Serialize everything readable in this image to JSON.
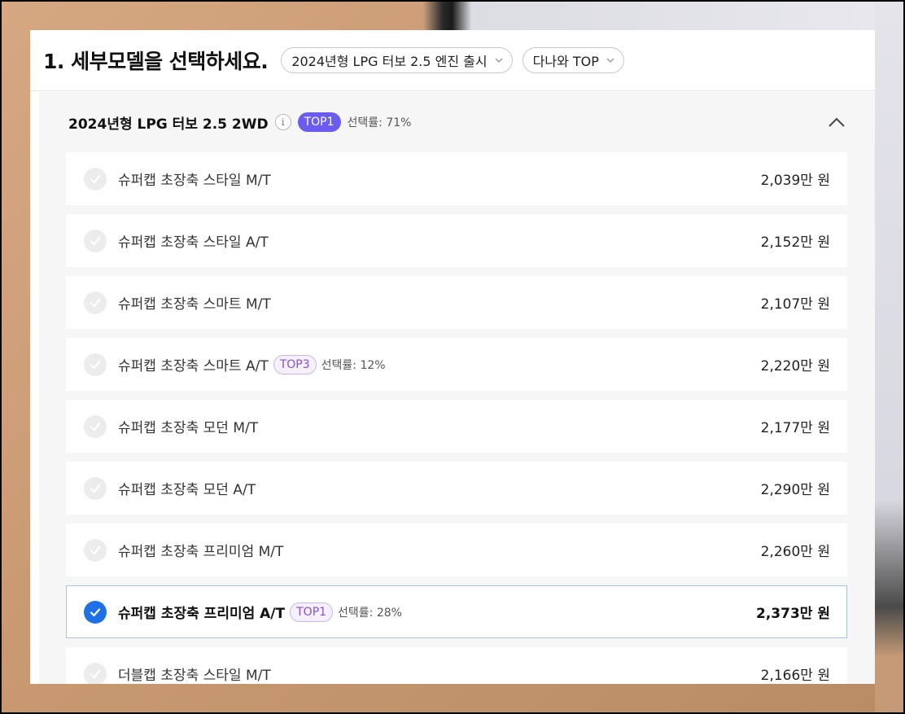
{
  "header": {
    "title": "1. 세부모델을 선택하세요.",
    "year_select": "2024년형 LPG 터보 2.5 엔진 출시",
    "sort_select": "다나와 TOP"
  },
  "group": {
    "title": "2024년형 LPG 터보 2.5 2WD",
    "badge": "TOP1",
    "rate": "선택률: 71%"
  },
  "options": [
    {
      "label": "슈퍼캡 초장축 스타일 M/T",
      "price": "2,039만 원"
    },
    {
      "label": "슈퍼캡 초장축 스타일 A/T",
      "price": "2,152만 원"
    },
    {
      "label": "슈퍼캡 초장축 스마트 M/T",
      "price": "2,107만 원"
    },
    {
      "label": "슈퍼캡 초장축 스마트 A/T",
      "price": "2,220만 원",
      "badge": "TOP3",
      "rate": "선택률: 12%"
    },
    {
      "label": "슈퍼캡 초장축 모던 M/T",
      "price": "2,177만 원"
    },
    {
      "label": "슈퍼캡 초장축 모던 A/T",
      "price": "2,290만 원"
    },
    {
      "label": "슈퍼캡 초장축 프리미엄 M/T",
      "price": "2,260만 원"
    },
    {
      "label": "슈퍼캡 초장축 프리미엄 A/T",
      "price": "2,373만 원",
      "badge": "TOP1",
      "rate": "선택률: 28%",
      "selected": true
    },
    {
      "label": "더블캡 초장축 스타일 M/T",
      "price": "2,166만 원"
    }
  ],
  "colors": {
    "accent_blue": "#1f6fe5",
    "badge_purple": "#6b5cf0"
  }
}
